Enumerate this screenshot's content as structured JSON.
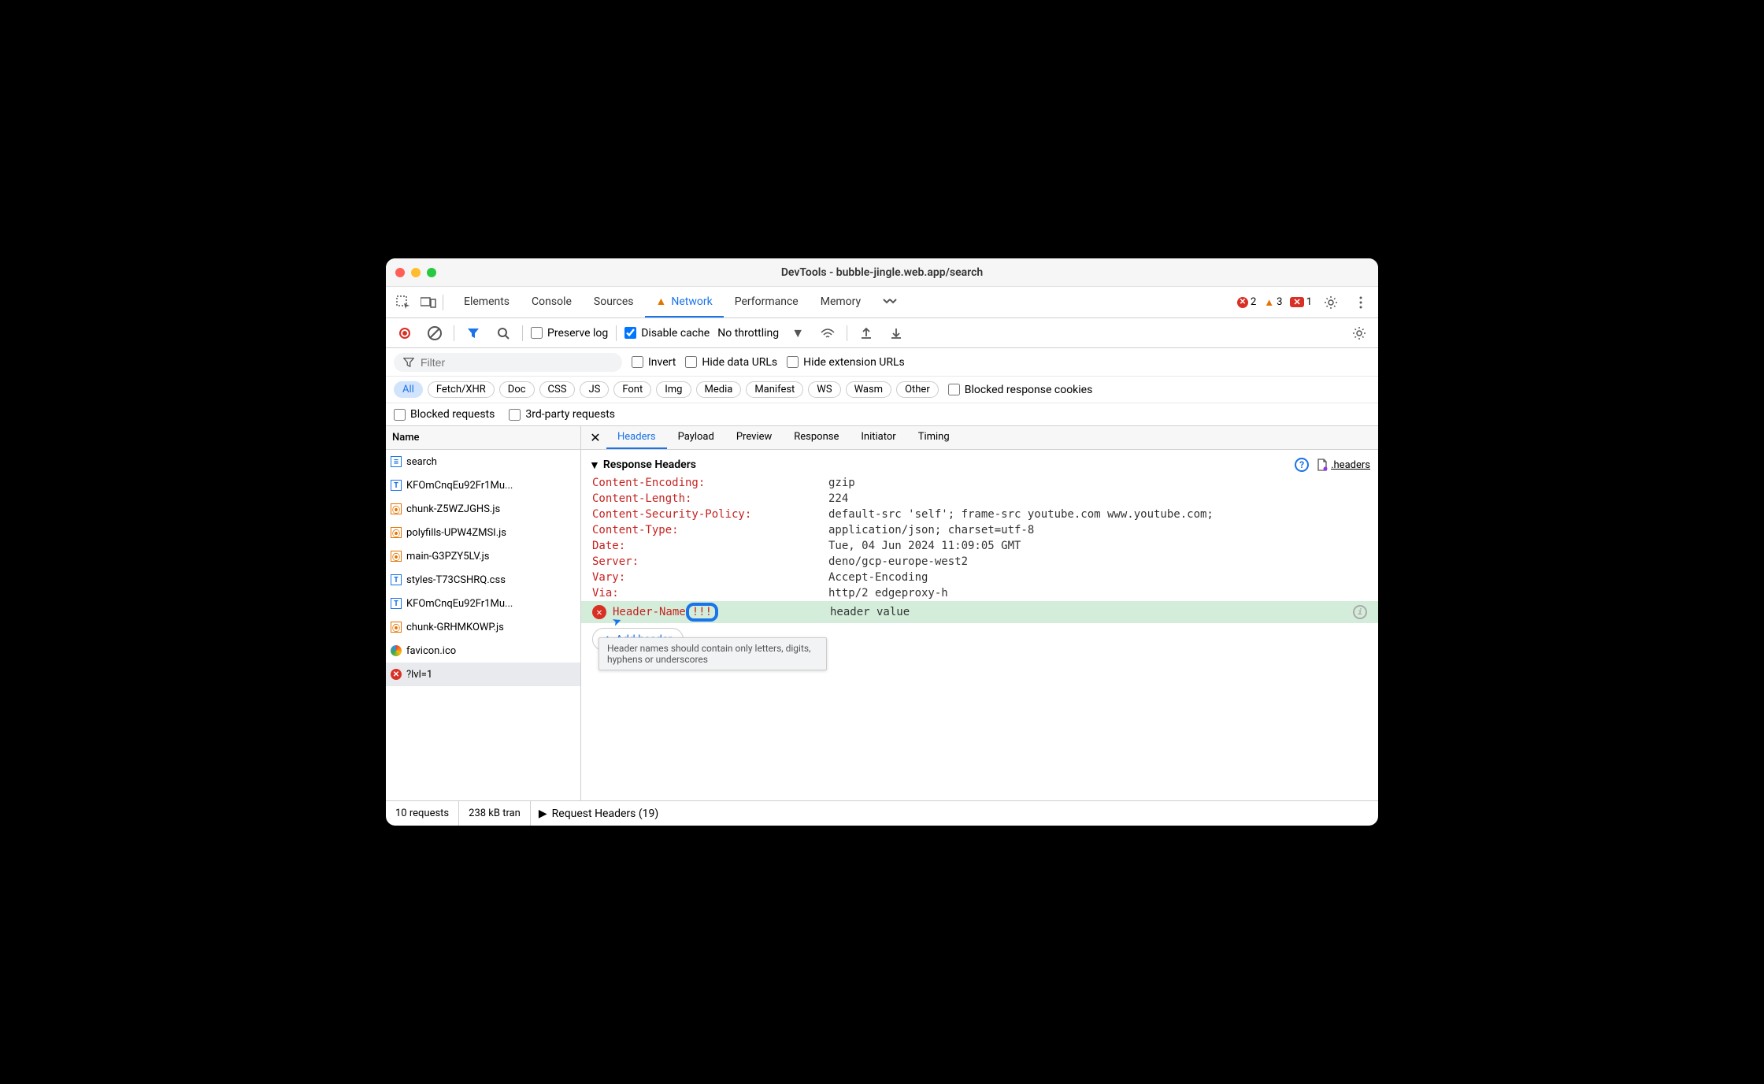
{
  "window": {
    "title": "DevTools - bubble-jingle.web.app/search"
  },
  "tabs": {
    "elements": "Elements",
    "console": "Console",
    "sources": "Sources",
    "network": "Network",
    "performance": "Performance",
    "memory": "Memory"
  },
  "counts": {
    "errors": "2",
    "warnings": "3",
    "extra": "1"
  },
  "toolbar": {
    "preserve_log": "Preserve log",
    "disable_cache": "Disable cache",
    "throttling": "No throttling"
  },
  "filter_row": {
    "placeholder": "Filter",
    "invert": "Invert",
    "hide_data": "Hide data URLs",
    "hide_ext": "Hide extension URLs"
  },
  "pills": {
    "all": "All",
    "fetch": "Fetch/XHR",
    "doc": "Doc",
    "css": "CSS",
    "js": "JS",
    "font": "Font",
    "img": "Img",
    "media": "Media",
    "manifest": "Manifest",
    "ws": "WS",
    "wasm": "Wasm",
    "other": "Other",
    "blocked_cookies": "Blocked response cookies"
  },
  "check_row": {
    "blocked_reqs": "Blocked requests",
    "third_party": "3rd-party requests"
  },
  "name_col": "Name",
  "requests": [
    {
      "label": "search",
      "type": "doc"
    },
    {
      "label": "KFOmCnqEu92Fr1Mu...",
      "type": "font"
    },
    {
      "label": "chunk-Z5WZJGHS.js",
      "type": "js"
    },
    {
      "label": "polyfills-UPW4ZMSI.js",
      "type": "js"
    },
    {
      "label": "main-G3PZY5LV.js",
      "type": "js"
    },
    {
      "label": "styles-T73CSHRQ.css",
      "type": "font"
    },
    {
      "label": "KFOmCnqEu92Fr1Mu...",
      "type": "font"
    },
    {
      "label": "chunk-GRHMKOWP.js",
      "type": "js"
    },
    {
      "label": "favicon.ico",
      "type": "ico"
    },
    {
      "label": "?lvl=1",
      "type": "err"
    }
  ],
  "detail_tabs": {
    "headers": "Headers",
    "payload": "Payload",
    "preview": "Preview",
    "response": "Response",
    "initiator": "Initiator",
    "timing": "Timing"
  },
  "sections": {
    "response_headers": "Response Headers",
    "headers_file": ".headers",
    "request_headers": "Request Headers (19)"
  },
  "headers": [
    {
      "name": "Content-Encoding:",
      "value": "gzip"
    },
    {
      "name": "Content-Length:",
      "value": "224"
    },
    {
      "name": "Content-Security-Policy:",
      "value": "default-src 'self'; frame-src youtube.com www.youtube.com;"
    },
    {
      "name": "Content-Type:",
      "value": "application/json; charset=utf-8"
    },
    {
      "name": "Date:",
      "value": "Tue, 04 Jun 2024 11:09:05 GMT"
    },
    {
      "name": "Server:",
      "value": "deno/gcp-europe-west2"
    },
    {
      "name": "Vary:",
      "value": "Accept-Encoding"
    },
    {
      "name": "Via:",
      "value": "http/2 edgeproxy-h"
    }
  ],
  "new_header": {
    "name_part": "Header-Name",
    "invalid": "!!!",
    "value": "header value"
  },
  "tooltip": "Header names should contain only letters, digits, hyphens or underscores",
  "add_header": "Add header",
  "status": {
    "requests": "10 requests",
    "transfer": "238 kB tran"
  }
}
